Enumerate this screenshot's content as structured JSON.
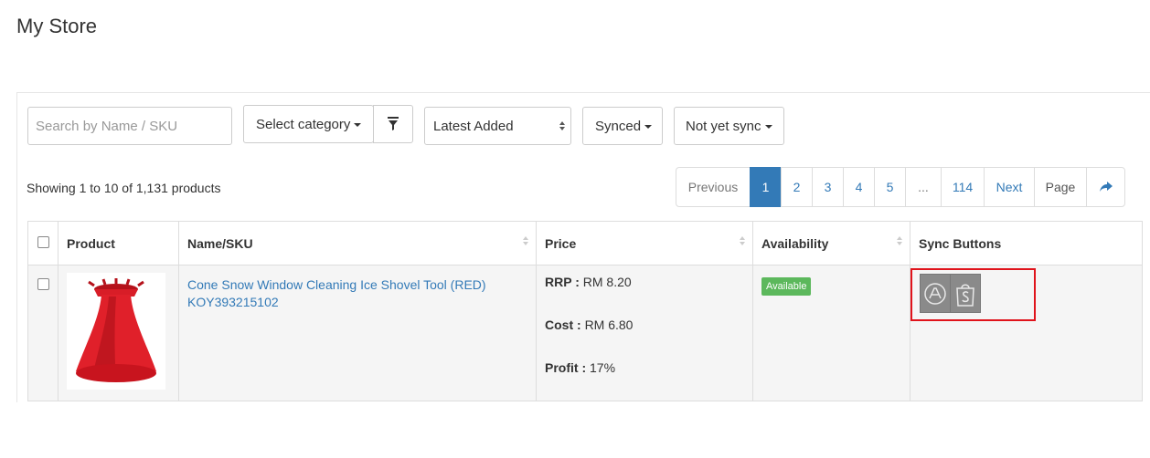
{
  "page": {
    "title": "My Store"
  },
  "toolbar": {
    "search_placeholder": "Search by Name / SKU",
    "category_label": "Select category",
    "sort_selected": "Latest Added",
    "synced_label": "Synced",
    "not_synced_label": "Not yet sync"
  },
  "listing": {
    "showing_text": "Showing 1 to 10 of 1,131 products"
  },
  "pagination": {
    "previous": "Previous",
    "pages": [
      "1",
      "2",
      "3",
      "4",
      "5"
    ],
    "ellipsis": "...",
    "last_page": "114",
    "next": "Next",
    "page_label": "Page",
    "current_page": "1"
  },
  "table": {
    "headers": {
      "product": "Product",
      "name_sku": "Name/SKU",
      "price": "Price",
      "availability": "Availability",
      "sync": "Sync Buttons"
    },
    "rows": [
      {
        "name": "Cone Snow Window Cleaning Ice Shovel Tool (RED)",
        "sku": "KOY393215102",
        "rrp_label": "RRP :",
        "rrp_value": "RM 8.20",
        "cost_label": "Cost :",
        "cost_value": "RM 6.80",
        "profit_label": "Profit :",
        "profit_value": "17%",
        "availability": "Available",
        "product_image_icon": "cone-ice-scraper-image",
        "sync_icons": [
          "lazada-sync-icon",
          "shopee-sync-icon"
        ]
      }
    ]
  },
  "colors": {
    "link": "#337ab7",
    "available_badge": "#5cb85c",
    "highlight_border": "#e0131b",
    "product_red": "#e0202a",
    "sync_button_bg": "#8a8a8a"
  }
}
